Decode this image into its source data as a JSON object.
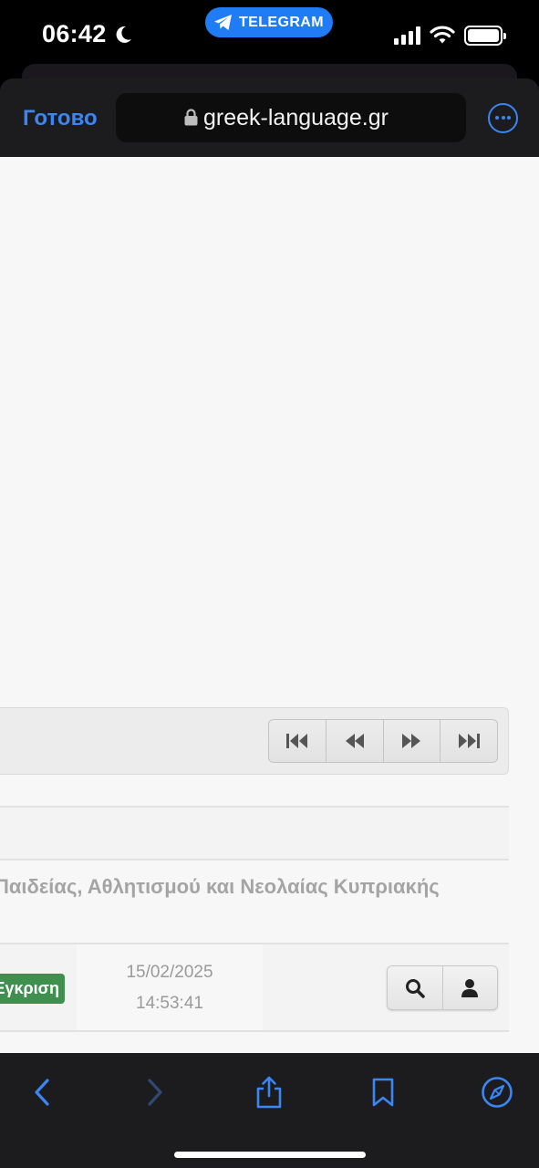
{
  "status_bar": {
    "time": "06:42",
    "pill_label": "TELEGRAM",
    "icons": [
      "moon-icon",
      "telegram-icon",
      "signal-icon",
      "wifi-icon",
      "battery-icon"
    ]
  },
  "browser": {
    "done_label": "Готово",
    "url": "greek-language.gr",
    "accent": "#3a86f2"
  },
  "pager": {
    "buttons": [
      "first-page-icon",
      "previous-page-icon",
      "next-page-icon",
      "last-page-icon"
    ]
  },
  "table": {
    "title_text": "Παιδείας, Αθλητισμού και Νεολαίας Κυπριακής",
    "rows": [
      {
        "status": "Έγκριση",
        "status_color": "#3f8f4f",
        "date": "15/02/2025",
        "time": "14:53:41",
        "actions": [
          "search-icon",
          "user-icon"
        ]
      }
    ]
  },
  "toolbar": {
    "buttons": [
      "back-icon",
      "forward-icon",
      "share-icon",
      "bookmarks-icon",
      "compass-icon"
    ]
  }
}
